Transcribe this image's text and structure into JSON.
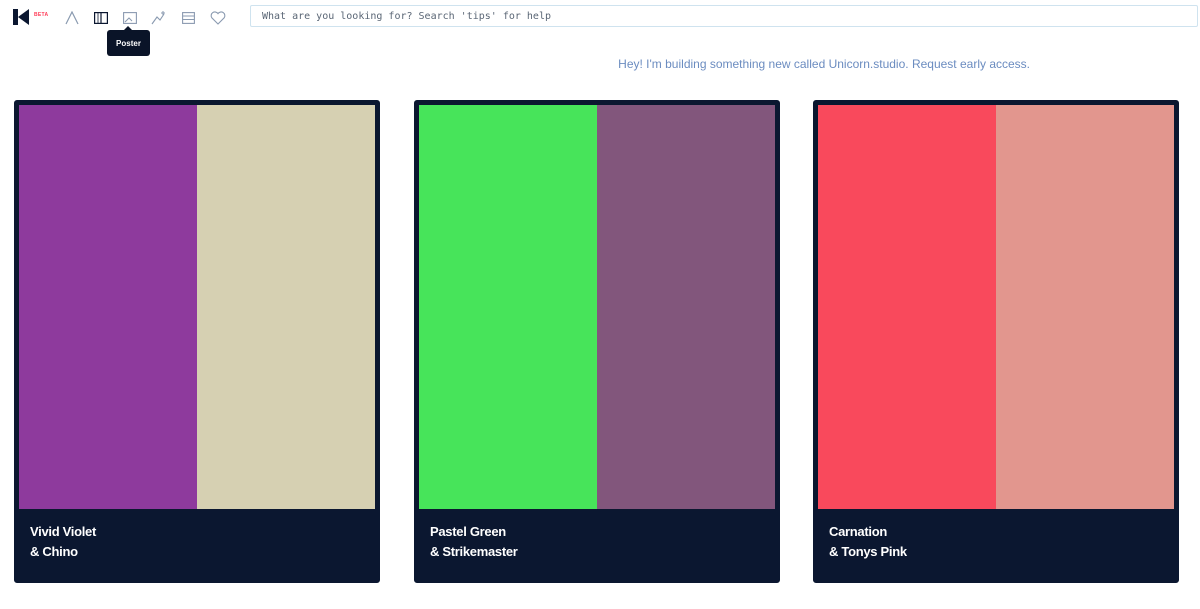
{
  "topbar": {
    "beta_label": "BETA",
    "tools": [
      {
        "icon": "type-icon"
      },
      {
        "icon": "columns-icon"
      },
      {
        "icon": "image-icon"
      },
      {
        "icon": "gradient-icon"
      },
      {
        "icon": "list-icon"
      },
      {
        "icon": "heart-icon"
      }
    ],
    "search_placeholder": "What are you looking for? Search 'tips' for help",
    "tooltip": "Poster"
  },
  "announcement": "Hey! I'm building something new called   Unicorn.studio. Request early access.",
  "cards": [
    {
      "line1": "Vivid Violet",
      "line2": "& Chino",
      "colors": [
        "#8e3a9d",
        "#d6d0b2"
      ]
    },
    {
      "line1": "Pastel Green",
      "line2": "& Strikemaster",
      "colors": [
        "#47e45a",
        "#82567c"
      ]
    },
    {
      "line1": "Carnation",
      "line2": "& Tonys Pink",
      "colors": [
        "#f9495c",
        "#e2968e"
      ]
    }
  ]
}
